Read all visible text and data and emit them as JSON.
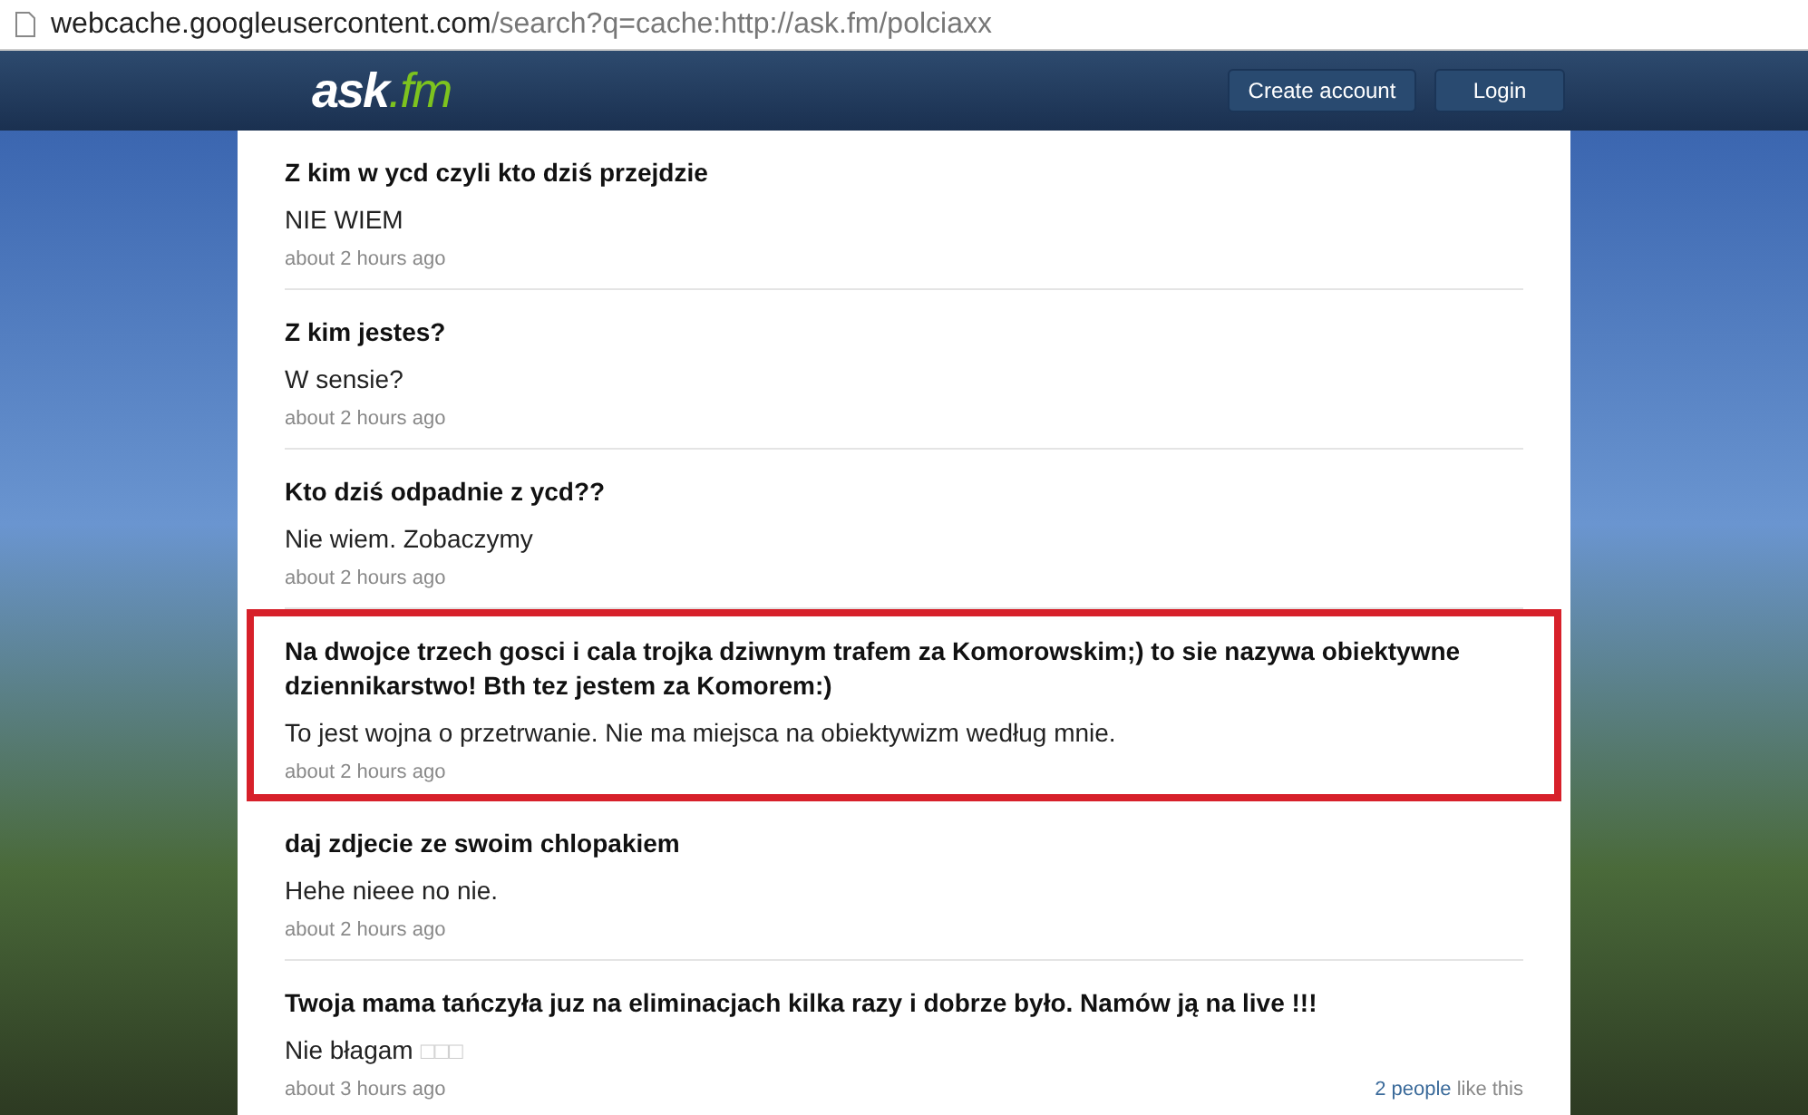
{
  "address_bar": {
    "host": "webcache.googleusercontent.com",
    "path": "/search?q=cache:http://ask.fm/polciaxx"
  },
  "header": {
    "logo": {
      "name": "ask",
      "suffix": ".fm"
    },
    "buttons": [
      "Create account",
      "Login"
    ]
  },
  "answers": [
    {
      "question": "Z kim w ycd czyli kto dziś przejdzie",
      "answer": "NIE WIEM",
      "time": "about 2 hours ago",
      "highlighted": false
    },
    {
      "question": "Z kim jestes?",
      "answer": "W sensie?",
      "time": "about 2 hours ago",
      "highlighted": false
    },
    {
      "question": "Kto dziś odpadnie z ycd??",
      "answer": "Nie wiem. Zobaczymy",
      "time": "about 2 hours ago",
      "highlighted": false
    },
    {
      "question": "Na dwojce trzech gosci i cala trojka dziwnym trafem za Komorowskim;) to sie nazywa obiektywne dziennikarstwo! Bth tez jestem za Komorem:)",
      "answer": "To jest wojna o przetrwanie. Nie ma miejsca na obiektywizm według mnie.",
      "time": "about 2 hours ago",
      "highlighted": true
    },
    {
      "question": "daj zdjecie ze swoim chlopakiem",
      "answer": "Hehe nieee no nie.",
      "time": "about 2 hours ago",
      "highlighted": false
    },
    {
      "question": "Twoja mama tańczyła juz na eliminacjach kilka razy i dobrze było. Namów ją na live !!!",
      "answer": "Nie błagam",
      "answer_glyphs": "□□□",
      "time": "about 3 hours ago",
      "likes_link": "2 people",
      "likes_text": "like this",
      "highlighted": false
    }
  ]
}
